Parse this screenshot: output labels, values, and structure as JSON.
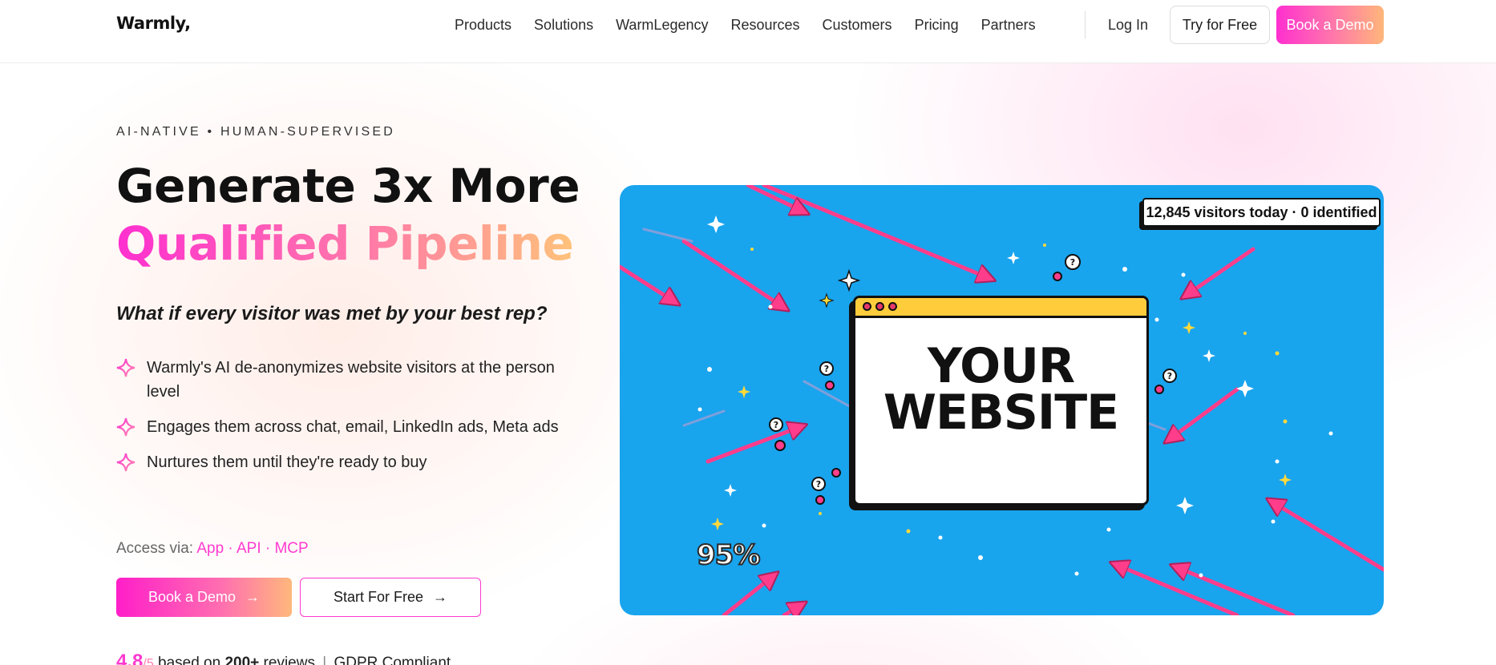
{
  "header": {
    "logo": "Warmly,",
    "nav": [
      "Products",
      "Solutions",
      "WarmLegency",
      "Resources",
      "Customers",
      "Pricing",
      "Partners"
    ],
    "login": "Log In",
    "try_free": "Try for Free",
    "book_demo": "Book a Demo"
  },
  "hero": {
    "eyebrow": "AI-NATIVE • HUMAN-SUPERVISED",
    "title_line1": "Generate 3x More",
    "title_line2": "Qualified Pipeline",
    "subtitle": "What if every visitor was met by your best rep?",
    "bullets": [
      "Warmly's AI de-anonymizes website visitors at the person level",
      "Engages them across chat, email, LinkedIn ads, Meta ads",
      "Nurtures them until they're ready to buy"
    ],
    "access_label": "Access via:",
    "access_links": "App · API · MCP",
    "cta_primary": "Book a Demo",
    "cta_secondary": "Start For Free",
    "rating_score": "4.8",
    "rating_denominator": "/5",
    "rating_prefix": "based on",
    "rating_count": "200+",
    "rating_suffix": "reviews",
    "rating_separator": "|",
    "compliance": "GDPR Compliant"
  },
  "illustration": {
    "badge": "12,845 visitors today · 0 identified",
    "browser_label_line1": "YOUR",
    "browser_label_line2": "WEBSITE",
    "percent": "95%"
  },
  "colors": {
    "accent_pink": "#ff2fd0",
    "accent_orange": "#ffb67a",
    "illustration_bg": "#19a4ee",
    "arrow": "#ff3d8b",
    "browser_bar": "#ffcd3c"
  },
  "icons": {
    "bullet": "sparkle-icon",
    "cta_arrow": "arrow-right-icon"
  }
}
